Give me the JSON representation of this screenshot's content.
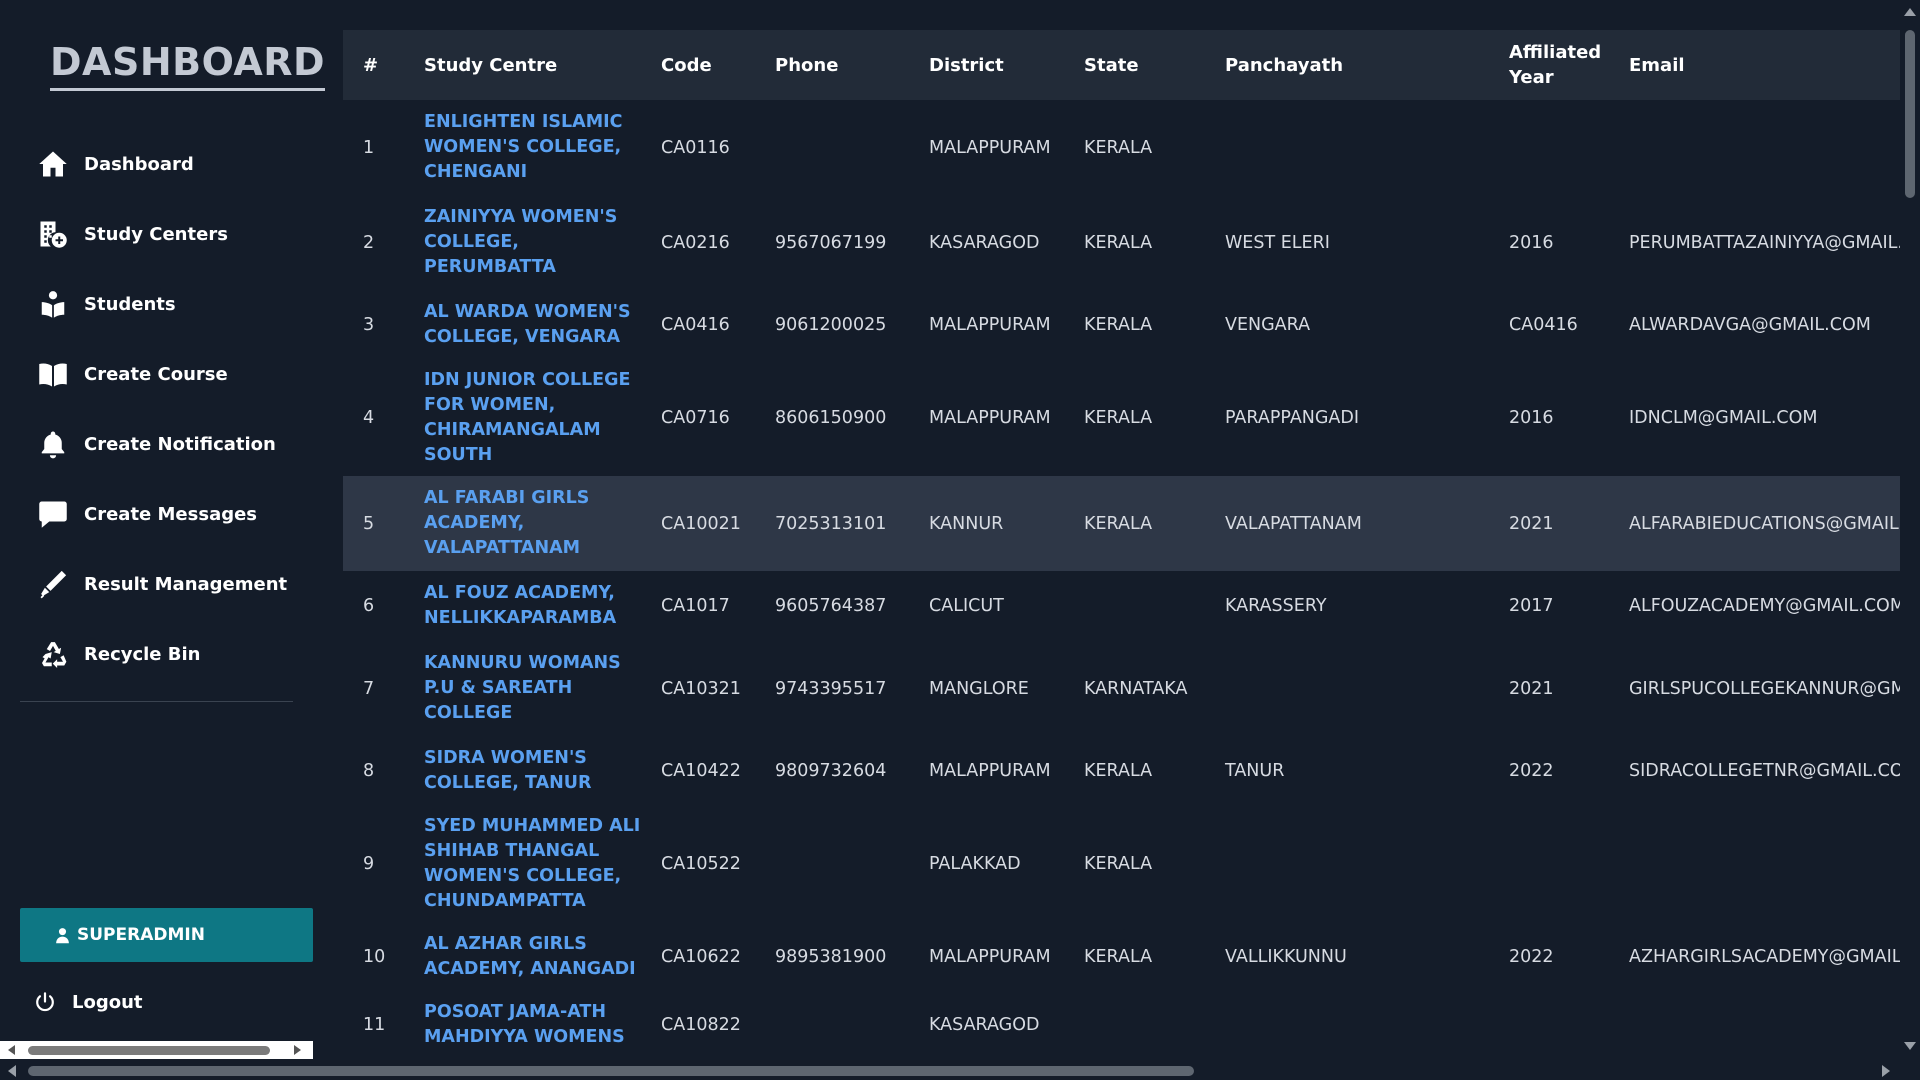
{
  "sidebar": {
    "brand": "DASHBOARD",
    "items": [
      {
        "label": "Dashboard",
        "icon": "home-icon"
      },
      {
        "label": "Study Centers",
        "icon": "building-add-icon"
      },
      {
        "label": "Students",
        "icon": "students-icon"
      },
      {
        "label": "Create Course",
        "icon": "book-icon"
      },
      {
        "label": "Create Notification",
        "icon": "bell-icon"
      },
      {
        "label": "Create Messages",
        "icon": "chat-icon"
      },
      {
        "label": "Result Management",
        "icon": "pen-icon"
      },
      {
        "label": "Recycle Bin",
        "icon": "recycle-icon"
      }
    ],
    "role": "SUPERADMIN",
    "logout": "Logout"
  },
  "table": {
    "headers": [
      "#",
      "Study Centre",
      "Code",
      "Phone",
      "District",
      "State",
      "Panchayath",
      "Affiliated Year",
      "Email"
    ],
    "rows": [
      {
        "no": "1",
        "centre": "ENLIGHTEN ISLAMIC WOMEN'S COLLEGE, CHENGANI",
        "code": "CA0116",
        "phone": "",
        "district": "MALAPPURAM",
        "state": "KERALA",
        "panchayath": "",
        "year": "",
        "email": ""
      },
      {
        "no": "2",
        "centre": "ZAINIYYA WOMEN'S COLLEGE, PERUMBATTA",
        "code": "CA0216",
        "phone": "9567067199",
        "district": "KASARAGOD",
        "state": "KERALA",
        "panchayath": "WEST ELERI",
        "year": "2016",
        "email": "PERUMBATTAZAINIYYA@GMAIL.COM"
      },
      {
        "no": "3",
        "centre": "AL WARDA WOMEN'S COLLEGE, VENGARA",
        "code": "CA0416",
        "phone": "9061200025",
        "district": "MALAPPURAM",
        "state": "KERALA",
        "panchayath": "VENGARA",
        "year": "CA0416",
        "email": "ALWARDAVGA@GMAIL.COM"
      },
      {
        "no": "4",
        "centre": "IDN JUNIOR COLLEGE FOR WOMEN, CHIRAMANGALAM SOUTH",
        "code": "CA0716",
        "phone": "8606150900",
        "district": "MALAPPURAM",
        "state": "KERALA",
        "panchayath": "PARAPPANGADI",
        "year": "2016",
        "email": "IDNCLM@GMAIL.COM"
      },
      {
        "no": "5",
        "centre": "AL FARABI GIRLS ACADEMY, VALAPATTANAM",
        "code": "CA10021",
        "phone": "7025313101",
        "district": "KANNUR",
        "state": "KERALA",
        "panchayath": "VALAPATTANAM",
        "year": "2021",
        "email": "ALFARABIEDUCATIONS@GMAIL.COM"
      },
      {
        "no": "6",
        "centre": "AL FOUZ ACADEMY, NELLIKKAPARAMBA",
        "code": "CA1017",
        "phone": "9605764387",
        "district": "CALICUT",
        "state": "",
        "panchayath": "KARASSERY",
        "year": "2017",
        "email": "ALFOUZACADEMY@GMAIL.COM"
      },
      {
        "no": "7",
        "centre": "KANNURU WOMANS P.U & SAREATH COLLEGE",
        "code": "CA10321",
        "phone": "9743395517",
        "district": "MANGLORE",
        "state": "KARNATAKA",
        "panchayath": "",
        "year": "2021",
        "email": "GIRLSPUCOLLEGEKANNUR@GMAIL.COM"
      },
      {
        "no": "8",
        "centre": "SIDRA WOMEN'S COLLEGE, TANUR",
        "code": "CA10422",
        "phone": "9809732604",
        "district": "MALAPPURAM",
        "state": "KERALA",
        "panchayath": "TANUR",
        "year": "2022",
        "email": "SIDRACOLLEGETNR@GMAIL.COM"
      },
      {
        "no": "9",
        "centre": "SYED MUHAMMED ALI SHIHAB THANGAL WOMEN'S COLLEGE, CHUNDAMPATTA",
        "code": "CA10522",
        "phone": "",
        "district": "PALAKKAD",
        "state": "KERALA",
        "panchayath": "",
        "year": "",
        "email": ""
      },
      {
        "no": "10",
        "centre": "AL AZHAR GIRLS ACADEMY, ANANGADI",
        "code": "CA10622",
        "phone": "9895381900",
        "district": "MALAPPURAM",
        "state": "KERALA",
        "panchayath": "VALLIKKUNNU",
        "year": "2022",
        "email": "AZHARGIRLSACADEMY@GMAIL.COM"
      },
      {
        "no": "11",
        "centre": "POSOAT JAMA-ATH MAHDIYYA WOMENS",
        "code": "CA10822",
        "phone": "",
        "district": "KASARAGOD",
        "state": "",
        "panchayath": "",
        "year": "",
        "email": ""
      }
    ]
  },
  "colors": {
    "background": "#141c29",
    "header": "#222b38",
    "highlight_row": "#2e3747",
    "link": "#5aa0f0",
    "role_button": "#0e7784"
  }
}
